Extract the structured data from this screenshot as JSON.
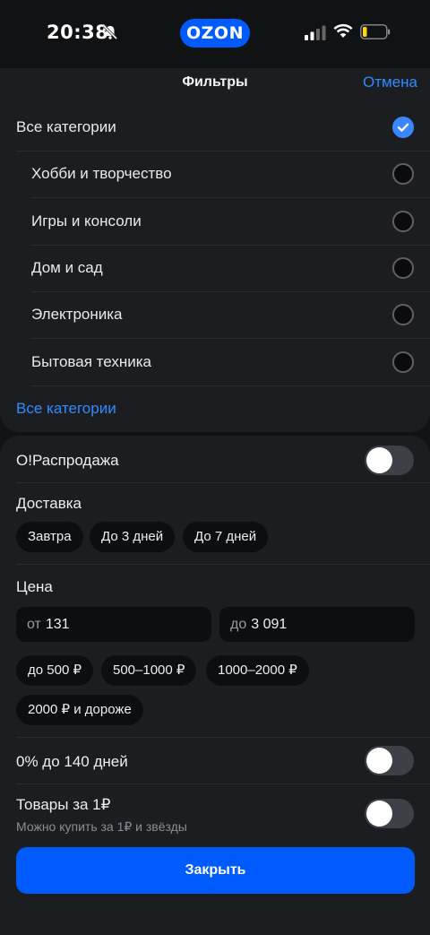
{
  "status": {
    "time": "20:38",
    "app_badge": "OZON"
  },
  "header": {
    "title": "Фильтры",
    "cancel_label": "Отмена"
  },
  "categories": {
    "items": [
      {
        "label": "Все категории",
        "checked": true
      },
      {
        "label": "Хобби и творчество",
        "checked": false
      },
      {
        "label": "Игры и консоли",
        "checked": false
      },
      {
        "label": "Дом и сад",
        "checked": false
      },
      {
        "label": "Электроника",
        "checked": false
      },
      {
        "label": "Бытовая техника",
        "checked": false
      }
    ],
    "all_link": "Все категории"
  },
  "filters": {
    "sale_label": "О!Распродажа",
    "sale_on": false,
    "delivery": {
      "label": "Доставка",
      "options": [
        "Завтра",
        "До 3 дней",
        "До 7 дней"
      ]
    },
    "price": {
      "label": "Цена",
      "from_prefix": "от",
      "from_value": "131",
      "to_prefix": "до",
      "to_value": "3 091",
      "ranges": [
        "до 500 ₽",
        "500–1000 ₽",
        "1000–2000 ₽",
        "2000 ₽ и дороже"
      ]
    },
    "installment_label": "0% до 140 дней",
    "installment_on": false,
    "one_ruble_label": "Товары за 1₽",
    "one_ruble_sub": "Можно купить за 1₽ и звёзды",
    "one_ruble_on": false
  },
  "footer": {
    "close_label": "Закрыть"
  },
  "colors": {
    "accent": "#005bff",
    "link": "#2f8cff",
    "check": "#3a86ff"
  }
}
